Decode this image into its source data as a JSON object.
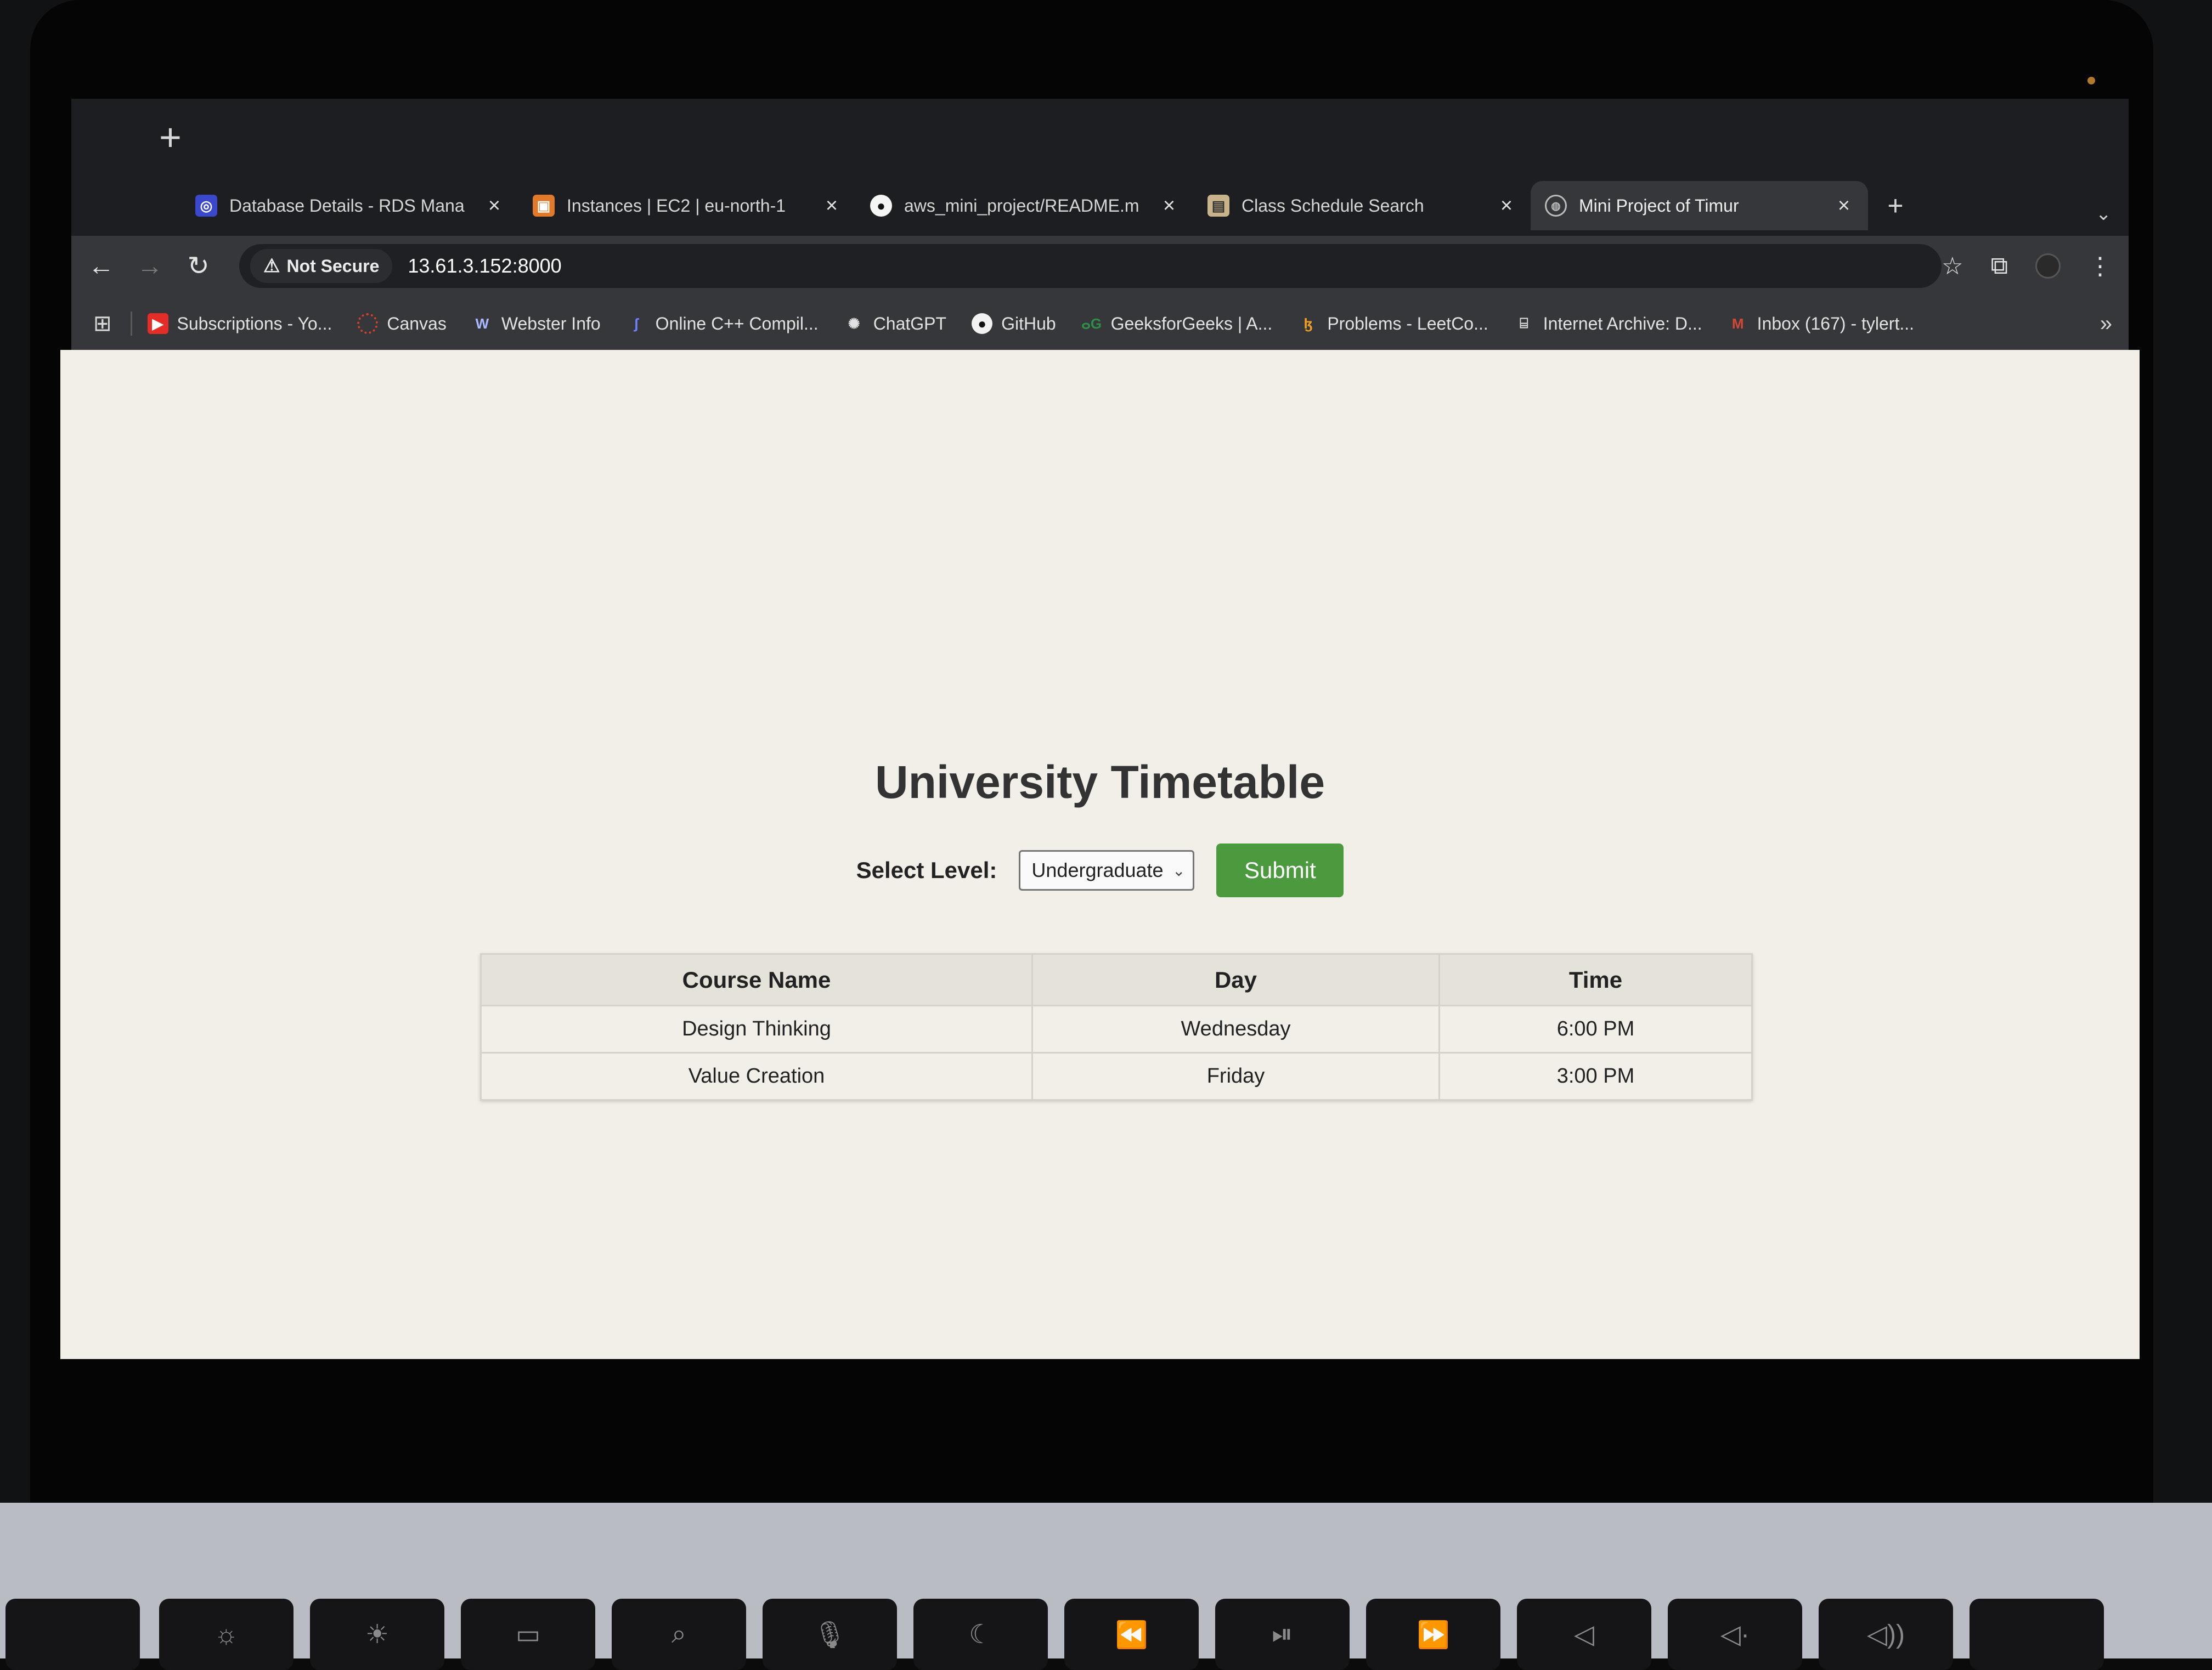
{
  "browser": {
    "tabs": [
      {
        "label": "Database Details - RDS Mana",
        "icon": "rds-icon",
        "active": false
      },
      {
        "label": "Instances | EC2 | eu-north-1",
        "icon": "ec2-icon",
        "active": false
      },
      {
        "label": "aws_mini_project/README.m",
        "icon": "github-icon",
        "active": false
      },
      {
        "label": "Class Schedule Search",
        "icon": "schedule-icon",
        "active": false
      },
      {
        "label": "Mini Project of Timur",
        "icon": "globe-icon",
        "active": true
      }
    ],
    "security_label": "Not Secure",
    "url": "13.61.3.152:8000",
    "bookmarks": [
      {
        "label": "Subscriptions - Yo...",
        "icon": "youtube-icon",
        "color": "#e52d27"
      },
      {
        "label": "Canvas",
        "icon": "canvas-icon",
        "color": "#d64027"
      },
      {
        "label": "Webster Info",
        "icon": "webster-icon",
        "color": "#1f3b8a"
      },
      {
        "label": "Online C++ Compil...",
        "icon": "compiler-icon",
        "color": "#3b5bdb"
      },
      {
        "label": "ChatGPT",
        "icon": "chatgpt-icon",
        "color": "#555555"
      },
      {
        "label": "GitHub",
        "icon": "github-icon",
        "color": "#222222"
      },
      {
        "label": "GeeksforGeeks | A...",
        "icon": "gfg-icon",
        "color": "#2f8d46"
      },
      {
        "label": "Problems - LeetCo...",
        "icon": "leetcode-icon",
        "color": "#f0a020"
      },
      {
        "label": "Internet Archive: D...",
        "icon": "archive-icon",
        "color": "#666666"
      },
      {
        "label": "Inbox (167) - tylert...",
        "icon": "gmail-icon",
        "color": "#d44638"
      }
    ]
  },
  "page": {
    "title": "University Timetable",
    "form": {
      "label": "Select Level:",
      "selected_level": "Undergraduate",
      "submit_label": "Submit"
    },
    "table": {
      "headers": [
        "Course Name",
        "Day",
        "Time"
      ],
      "rows": [
        [
          "Design Thinking",
          "Wednesday",
          "6:00 PM"
        ],
        [
          "Value Creation",
          "Friday",
          "3:00 PM"
        ]
      ]
    }
  },
  "colors": {
    "accent_green": "#4c9a3e",
    "page_background": "#f1efe7"
  }
}
